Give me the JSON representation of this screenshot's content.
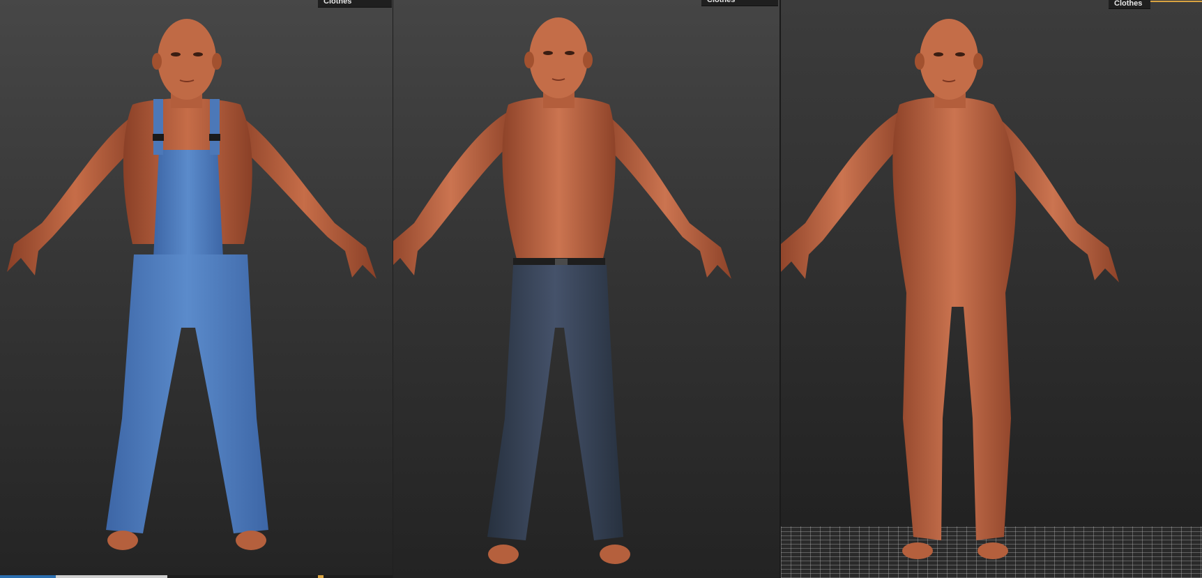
{
  "viewports": [
    {
      "tab_label": "Clothes",
      "outfit": "overalls"
    },
    {
      "tab_label": "Clothes",
      "outfit": "jeans"
    },
    {
      "tab_label": "Clothes",
      "outfit": "none"
    }
  ],
  "colors": {
    "skin": "#b8603f",
    "skin_light": "#cf7a55",
    "skin_dark": "#8a4027",
    "denim_light": "#4f7fc0",
    "denim_dark": "#2e3a4f",
    "accent": "#d9a441"
  }
}
